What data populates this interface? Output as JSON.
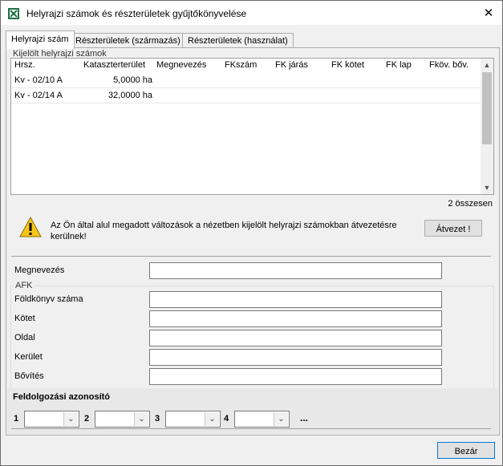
{
  "window": {
    "title": "Helyrajzi számok és részterületek gyűjtőkönyvelése",
    "close_glyph": "✕"
  },
  "tabs": [
    {
      "label": "Helyrajzi szám"
    },
    {
      "label": "Részterületek (származás)"
    },
    {
      "label": "Részterületek (használat)"
    }
  ],
  "selected_group": {
    "label": "Kijelölt helyrajzi számok",
    "columns": [
      "Hrsz.",
      "Kataszterterület",
      "Megnevezés",
      "FKszám",
      "FK járás",
      "FK kötet",
      "FK lap",
      "Fköv. bőv."
    ],
    "rows": [
      {
        "hrsz": "Kv - 02/10 A",
        "area": "5,0000 ha"
      },
      {
        "hrsz": "Kv - 02/14 A",
        "area": "32,0000 ha"
      }
    ],
    "count_text": "2 összesen"
  },
  "warning": {
    "icon": "warning-icon",
    "text": "Az Ön által alul megadott változások a nézetben kijelölt helyrajzi számokban átvezetésre kerülnek!",
    "apply_label": "Átvezet !"
  },
  "fields": {
    "name_label": "Megnevezés",
    "afk_label": "AFK",
    "land_registry_label": "Földkönyv száma",
    "volume_label": "Kötet",
    "page_label": "Oldal",
    "district_label": "Kerület",
    "extension_label": "Bővítés"
  },
  "processing": {
    "title": "Feldolgozási azonosító",
    "combos": [
      {
        "num": "1"
      },
      {
        "num": "2"
      },
      {
        "num": "3"
      },
      {
        "num": "4"
      }
    ],
    "more": "..."
  },
  "footer": {
    "close_label": "Bezár"
  },
  "colors": {
    "window_bg": "#f0f0f0",
    "accent": "#0078d7",
    "warning": "#f5c518"
  }
}
